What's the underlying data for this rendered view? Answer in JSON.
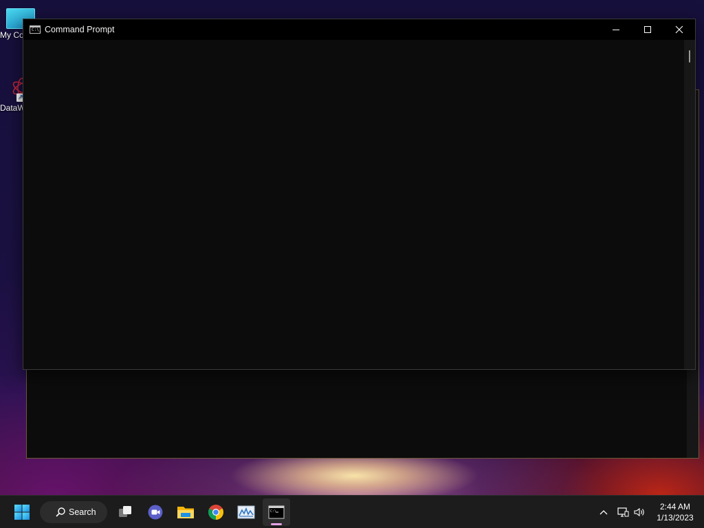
{
  "desktop": {
    "icons": [
      {
        "label": "My Computer",
        "icon": "monitor-icon"
      },
      {
        "label": "DataWrapper",
        "icon": "datawrapper-logo-icon"
      }
    ]
  },
  "window": {
    "title": "Command Prompt",
    "icon": "cmd-icon",
    "icon_text": "C:\\_",
    "controls": [
      "minimize",
      "maximize",
      "close"
    ]
  },
  "taskbar": {
    "search_label": "Search",
    "apps": [
      {
        "name": "Task View",
        "icon": "task-view-icon"
      },
      {
        "name": "Meet",
        "icon": "meet-icon"
      },
      {
        "name": "File Explorer",
        "icon": "folder-icon"
      },
      {
        "name": "Google Chrome",
        "icon": "chrome-icon"
      },
      {
        "name": "Performance Monitor",
        "icon": "perfmon-icon"
      },
      {
        "name": "Command Prompt",
        "icon": "cmd-icon",
        "active": true
      }
    ],
    "accent_color": "#e7a2e8"
  },
  "tray": {
    "time": "2:44 AM",
    "date": "1/13/2023"
  }
}
